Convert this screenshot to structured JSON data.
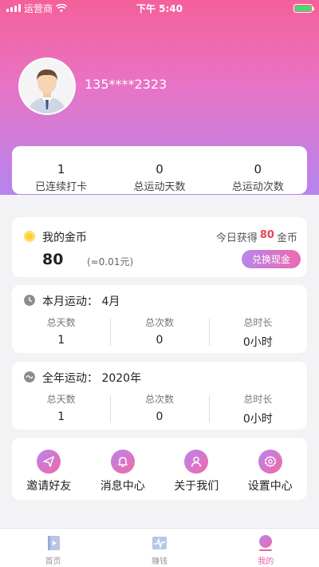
{
  "status_bar": {
    "carrier": "运营商",
    "time": "下午 5:40"
  },
  "profile": {
    "phone": "135****2323"
  },
  "stats": [
    {
      "value": "1",
      "label": "已连续打卡"
    },
    {
      "value": "0",
      "label": "总运动天数"
    },
    {
      "value": "0",
      "label": "总运动次数"
    }
  ],
  "coins": {
    "title": "我的金币",
    "today_prefix": "今日获得",
    "today_value": "80",
    "today_suffix": "金币",
    "amount": "80",
    "approx": "(≈0.01元)",
    "exchange_label": "兑换现金"
  },
  "month": {
    "title": "本月运动：  4月",
    "cols": [
      {
        "header": "总天数",
        "value": "1"
      },
      {
        "header": "总次数",
        "value": "0"
      },
      {
        "header": "总时长",
        "value": "0小时"
      }
    ]
  },
  "year": {
    "title": "全年运动：  2020年",
    "cols": [
      {
        "header": "总天数",
        "value": "1"
      },
      {
        "header": "总次数",
        "value": "0"
      },
      {
        "header": "总时长",
        "value": "0小时"
      }
    ]
  },
  "menu": [
    {
      "label": "邀请好友",
      "icon": "paper-plane-icon"
    },
    {
      "label": "消息中心",
      "icon": "bell-icon"
    },
    {
      "label": "关于我们",
      "icon": "user-icon"
    },
    {
      "label": "设置中心",
      "icon": "gear-icon"
    }
  ],
  "tabs": [
    {
      "label": "首页",
      "icon": "book-icon"
    },
    {
      "label": "赚钱",
      "icon": "pulse-icon"
    },
    {
      "label": "我的",
      "icon": "profile-icon",
      "active": true
    }
  ],
  "colors": {
    "accent": "#e85fa6",
    "highlight": "#e94357",
    "gradient_top": "#f5609a",
    "gradient_bottom": "#b584ee"
  }
}
